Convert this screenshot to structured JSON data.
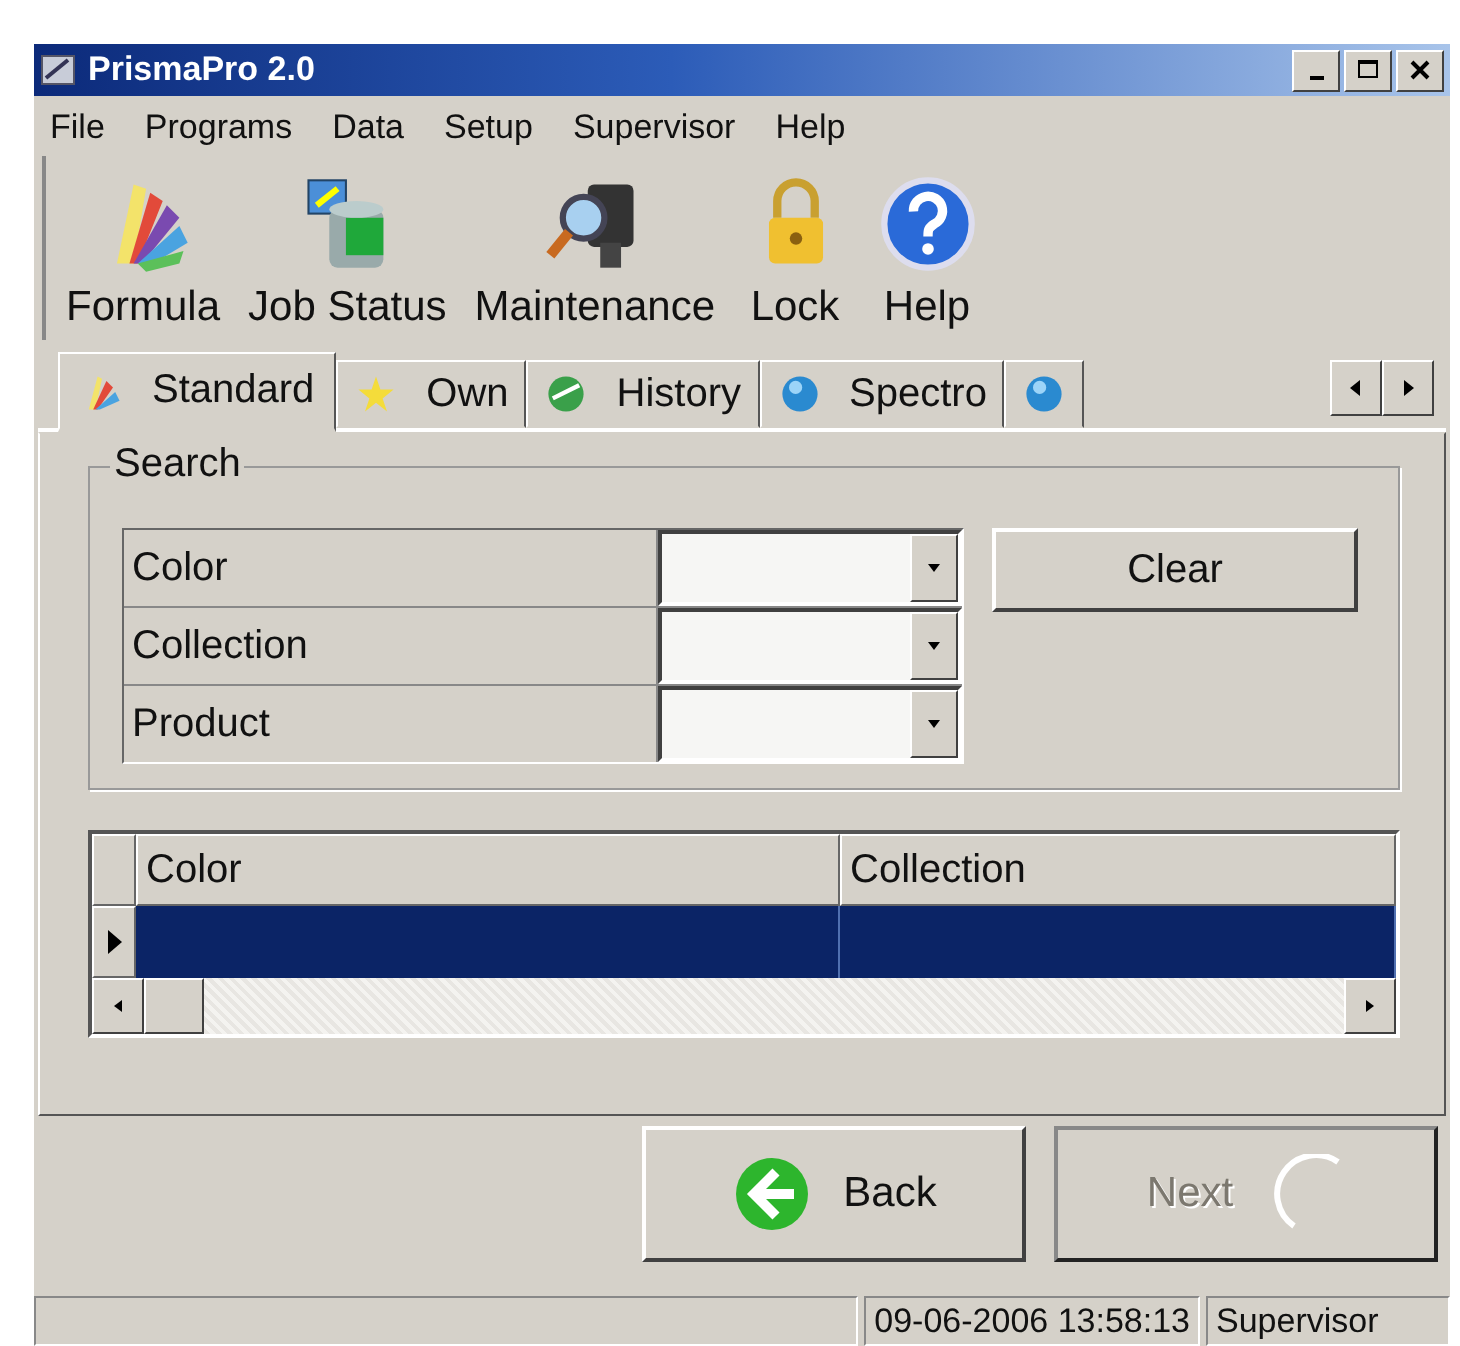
{
  "window": {
    "title": "PrismaPro 2.0"
  },
  "menu": [
    "File",
    "Programs",
    "Data",
    "Setup",
    "Supervisor",
    "Help"
  ],
  "toolbar": [
    {
      "label": "Formula",
      "kind": "fan"
    },
    {
      "label": "Job Status",
      "kind": "status"
    },
    {
      "label": "Maintenance",
      "kind": "magnifier"
    },
    {
      "label": "Lock",
      "kind": "lock"
    },
    {
      "label": "Help",
      "kind": "help"
    }
  ],
  "tabs": [
    {
      "label": "Standard",
      "kind": "fan",
      "selected": true
    },
    {
      "label": "Own",
      "kind": "star",
      "selected": false
    },
    {
      "label": "History",
      "kind": "globe",
      "selected": false
    },
    {
      "label": "Spectro",
      "kind": "orb",
      "selected": false
    },
    {
      "kind": "orb",
      "selected": false
    }
  ],
  "search": {
    "title": "Search",
    "fields": [
      {
        "label": "Color"
      },
      {
        "label": "Collection"
      },
      {
        "label": "Product"
      }
    ],
    "clear_button": "Clear"
  },
  "table": {
    "columns": [
      "Color",
      "Collection"
    ],
    "rows": [
      {
        "selected": true
      }
    ]
  },
  "buttons": [
    {
      "label": "Back",
      "kind": "back",
      "disabled": false
    },
    {
      "label": "Next",
      "kind": "next",
      "disabled": true
    }
  ],
  "status_bar": {
    "datetime": "09-06-2006 13:58:13",
    "user": "Supervisor"
  }
}
